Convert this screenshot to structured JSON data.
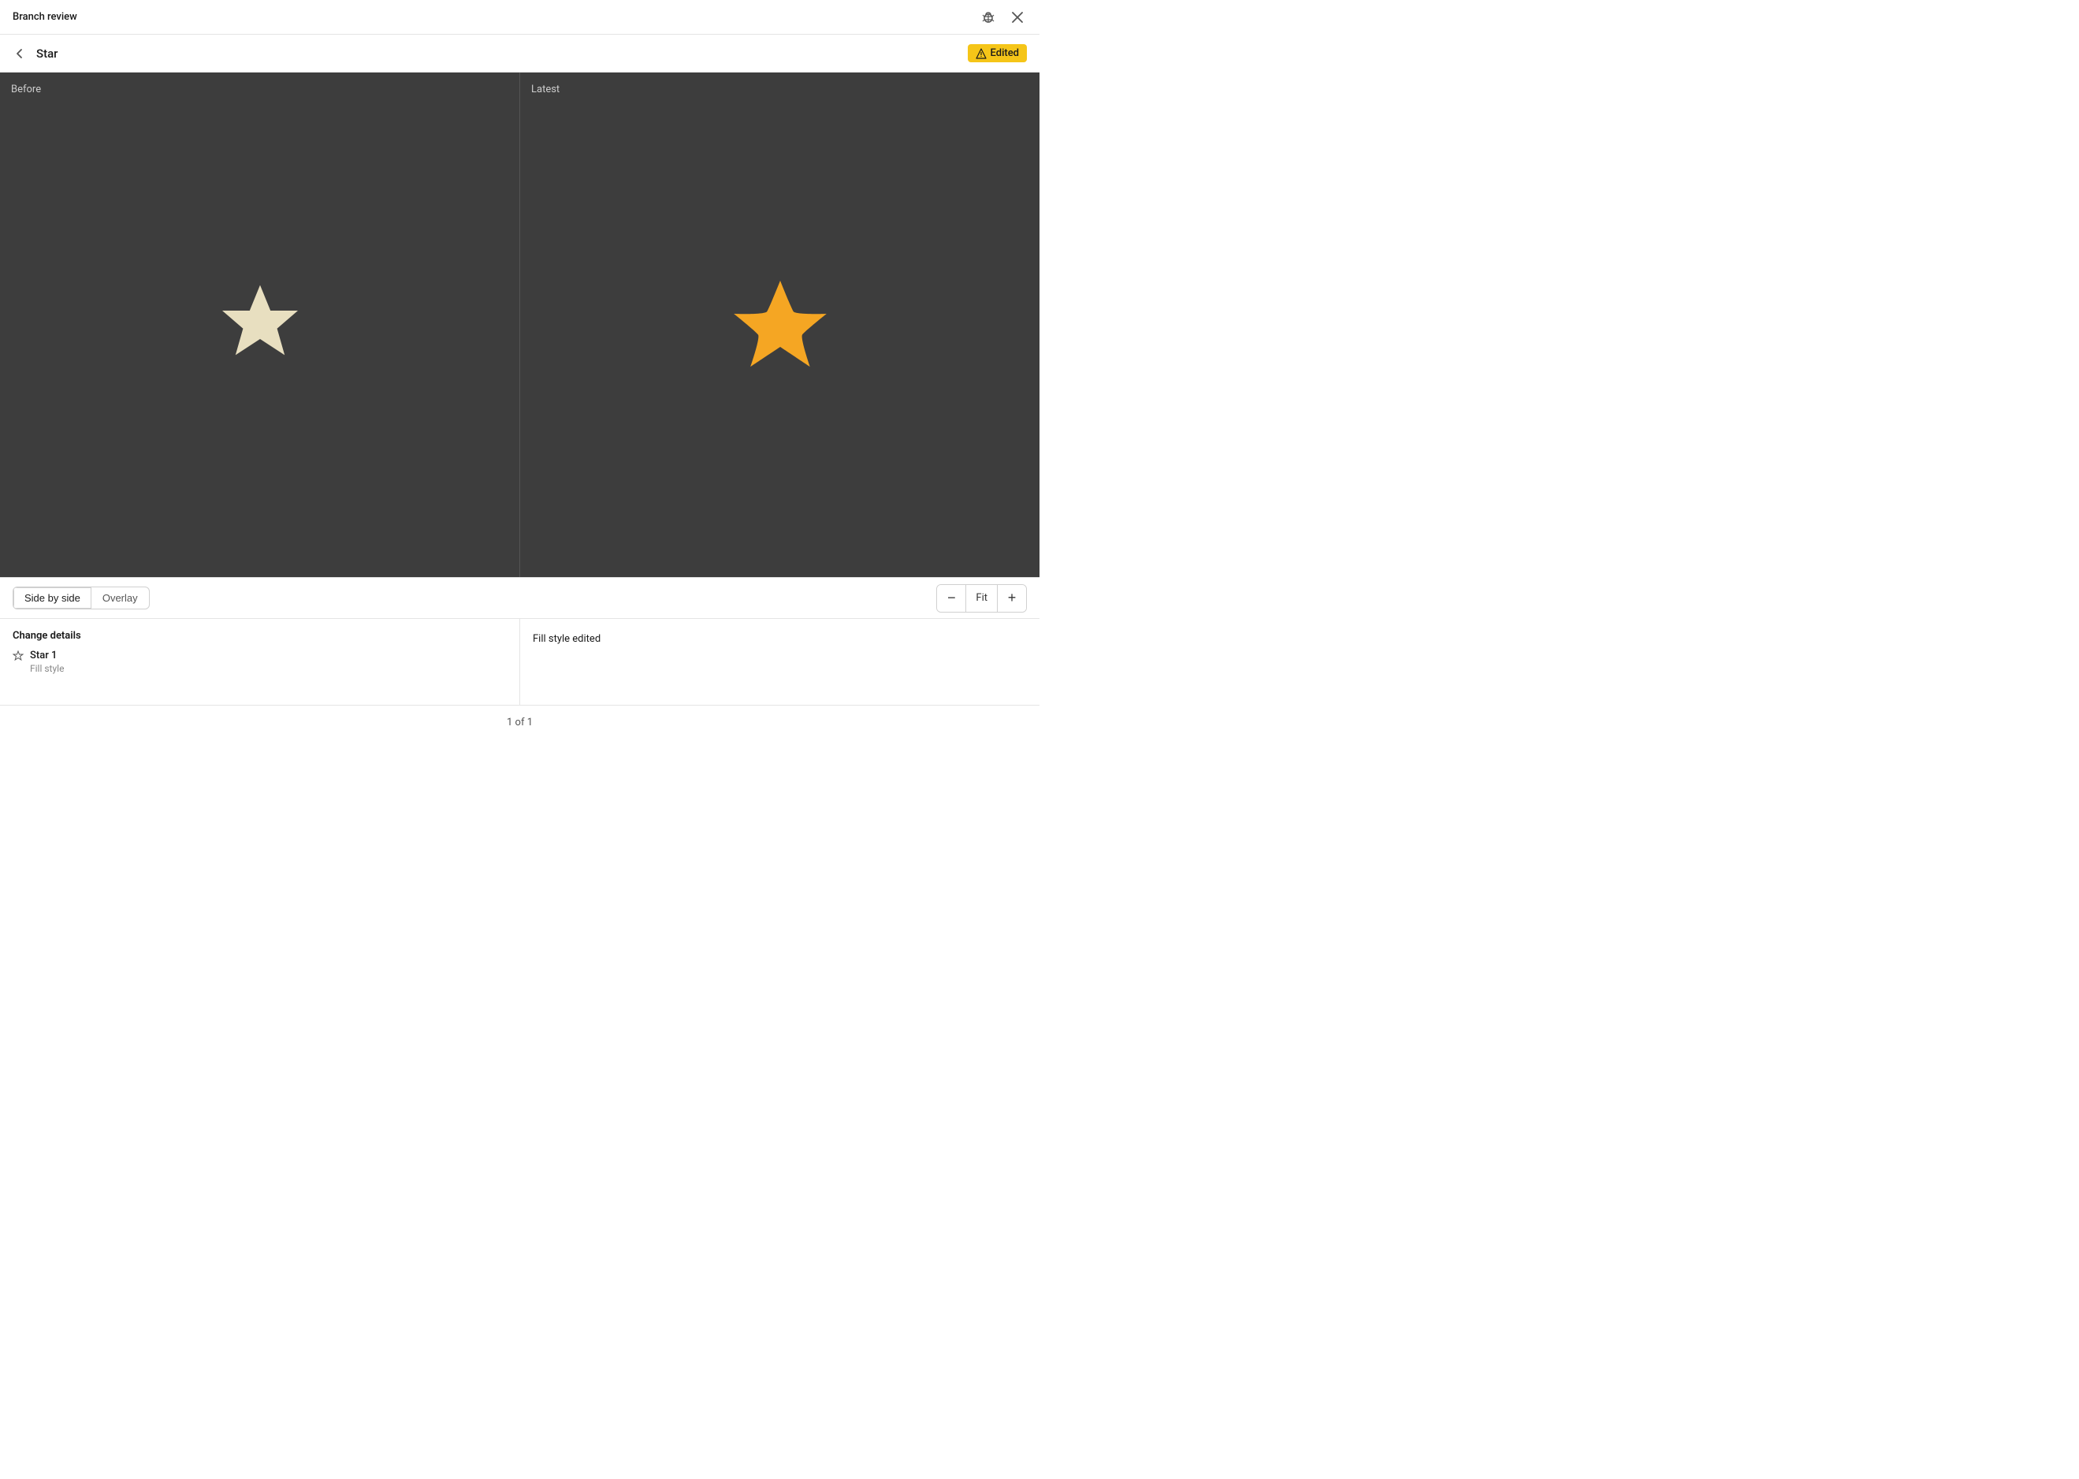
{
  "title_bar": {
    "title": "Branch review",
    "bug_icon": "bug-icon",
    "close_icon": "close-icon"
  },
  "nav_bar": {
    "back_icon": "back-icon",
    "component_name": "Star",
    "edited_badge": {
      "icon": "warning-triangle-icon",
      "label": "Edited"
    }
  },
  "before_pane": {
    "label": "Before",
    "star_color": "#e8dfc0"
  },
  "latest_pane": {
    "label": "Latest",
    "star_color": "#f5a623"
  },
  "bottom_toolbar": {
    "view_options": [
      {
        "label": "Side by side",
        "active": true
      },
      {
        "label": "Overlay",
        "active": false
      }
    ],
    "zoom": {
      "minus_label": "−",
      "fit_label": "Fit",
      "plus_label": "+"
    }
  },
  "change_details": {
    "section_title": "Change details",
    "item": {
      "icon": "star-outline-icon",
      "label": "Star 1",
      "sub_label": "Fill style"
    },
    "right_label": "Fill style edited"
  },
  "footer": {
    "text": "1 of 1"
  }
}
